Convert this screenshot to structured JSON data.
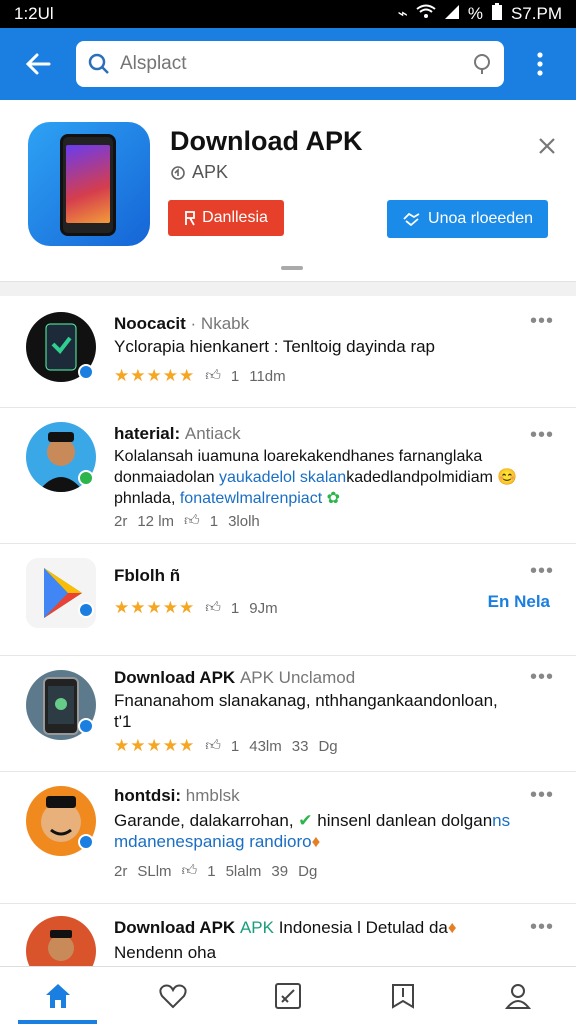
{
  "status": {
    "time": "1:2Ul",
    "battery": "%",
    "clock": "S7.PM"
  },
  "search": {
    "placeholder": "Alsplact"
  },
  "banner": {
    "title": "Download APK",
    "subtitle": "APK",
    "primary_button": "Danllesia",
    "secondary_button": "Unoa rloeeden"
  },
  "feed": [
    {
      "name": "Noocacit",
      "handle": "Nkabk",
      "text": "Yclorapia hienkanert : Tenltoig dayinda rap",
      "stars": "★★★★★",
      "likes": "1",
      "time": "11dm"
    },
    {
      "name": "haterial:",
      "handle": "Antiack",
      "text": "Kolalansah iuamuna loarekakendhanes farnanglaka",
      "text2": "donmaiadolan",
      "link2": "yaukadelol skalan",
      "text2b": "kadedlandpolmidiam",
      "text3": "phnlada,",
      "link3": "fonatewlmalrenpiact",
      "stat1": "2r",
      "stat2": "12 lm",
      "likes": "1",
      "time": "3lolh"
    },
    {
      "name": "Fblolh",
      "handle": "ñ",
      "stars": "★★★★★",
      "likes": "1",
      "time": "9Jm",
      "side_link": "En Nela"
    },
    {
      "name": "Download APK",
      "handle": "APK Unclamod",
      "text": "Fnananahom slanakanag, nthhangankaandonloan,",
      "text2": "t'1",
      "stars": "★★★★★",
      "likes": "1",
      "time": "43lm",
      "stat3": "33",
      "stat4": "Dg"
    },
    {
      "name": "hontdsi:",
      "handle": "hmblsk",
      "text": "Garande, dalakarrohan,",
      "text_b": "hinsenl danlean dolgan",
      "link1": "ns",
      "text2": "mdanenespaniag",
      "link2": "randioro",
      "stat1": "2r",
      "stat2": "SLlm",
      "likes": "1",
      "time": "5lalm",
      "stat3": "39",
      "stat4": "Dg"
    },
    {
      "name": "Download APK",
      "handle": "APK",
      "handle2": "Indonesia l Detulad da",
      "text": "Nendenn oha"
    }
  ],
  "colors": {
    "accent": "#1a7fe0",
    "danger": "#e6402a",
    "star": "#f5a623"
  },
  "nav": [
    "home-icon",
    "heart-icon",
    "edit-icon",
    "bookmark-icon",
    "profile-icon"
  ]
}
